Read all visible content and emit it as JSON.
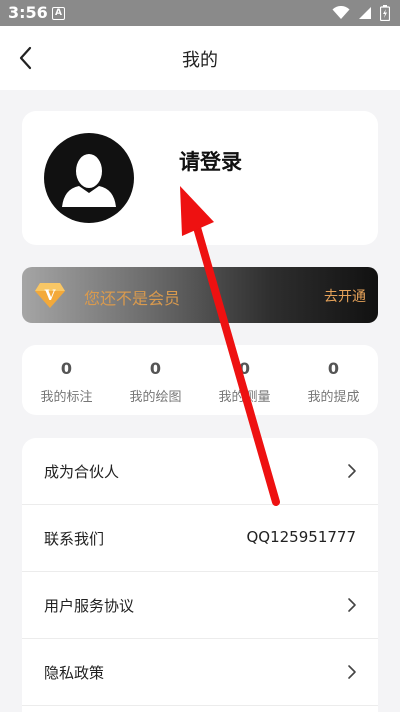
{
  "status_bar": {
    "time": "3:56",
    "notif_letter": "A"
  },
  "nav": {
    "title": "我的"
  },
  "profile": {
    "login_text": "请登录"
  },
  "vip": {
    "badge_letter": "V",
    "message": "您还不是会员",
    "action": "去开通",
    "text_color": "#d99a4e",
    "action_color": "#e6a259"
  },
  "stats": [
    {
      "value": "0",
      "label": "我的标注"
    },
    {
      "value": "0",
      "label": "我的绘图"
    },
    {
      "value": "0",
      "label": "我的测量"
    },
    {
      "value": "0",
      "label": "我的提成"
    }
  ],
  "menu": [
    {
      "label": "成为合伙人",
      "value": ""
    },
    {
      "label": "联系我们",
      "value": "QQ125951777"
    },
    {
      "label": "用户服务协议",
      "value": ""
    },
    {
      "label": "隐私政策",
      "value": ""
    }
  ],
  "annotation": {
    "color": "#ee1111",
    "icon": "red-arrow-icon"
  }
}
